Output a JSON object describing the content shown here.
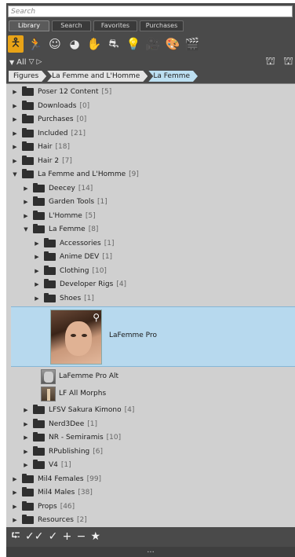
{
  "search": {
    "placeholder": "Search",
    "value": ""
  },
  "tabs": [
    "Library",
    "Search",
    "Favorites",
    "Purchases"
  ],
  "filter": {
    "label": "All"
  },
  "breadcrumb": [
    "Figures",
    "La Femme and L'Homme",
    "La Femme"
  ],
  "tree": [
    {
      "label": "Poser 12 Content",
      "count": "[5]"
    },
    {
      "label": "Downloads",
      "count": "[0]"
    },
    {
      "label": "Purchases",
      "count": "[0]"
    },
    {
      "label": "Included",
      "count": "[21]"
    },
    {
      "label": "Hair",
      "count": "[18]"
    },
    {
      "label": "Hair 2",
      "count": "[7]"
    },
    {
      "label": "La Femme and L'Homme",
      "count": "[9]"
    },
    {
      "label": "Deecey",
      "count": "[14]"
    },
    {
      "label": "Garden Tools",
      "count": "[1]"
    },
    {
      "label": "L'Homme",
      "count": "[5]"
    },
    {
      "label": "La Femme",
      "count": "[8]"
    },
    {
      "label": "Accessories",
      "count": "[1]"
    },
    {
      "label": "Anime DEV",
      "count": "[1]"
    },
    {
      "label": "Clothing",
      "count": "[10]"
    },
    {
      "label": "Developer Rigs",
      "count": "[4]"
    },
    {
      "label": "Shoes",
      "count": "[1]"
    },
    {
      "label": "LFSV Sakura Kimono",
      "count": "[4]"
    },
    {
      "label": "Nerd3Dee",
      "count": "[1]"
    },
    {
      "label": "NR - Semiramis",
      "count": "[10]"
    },
    {
      "label": "RPublishing",
      "count": "[6]"
    },
    {
      "label": "V4",
      "count": "[1]"
    },
    {
      "label": "Mil4 Females",
      "count": "[99]"
    },
    {
      "label": "Mil4 Males",
      "count": "[38]"
    },
    {
      "label": "Props",
      "count": "[46]"
    },
    {
      "label": "Resources",
      "count": "[2]"
    }
  ],
  "items": {
    "selected": "LaFemme Pro",
    "alt": "LaFemme Pro Alt",
    "morphs": "LF All Morphs"
  }
}
